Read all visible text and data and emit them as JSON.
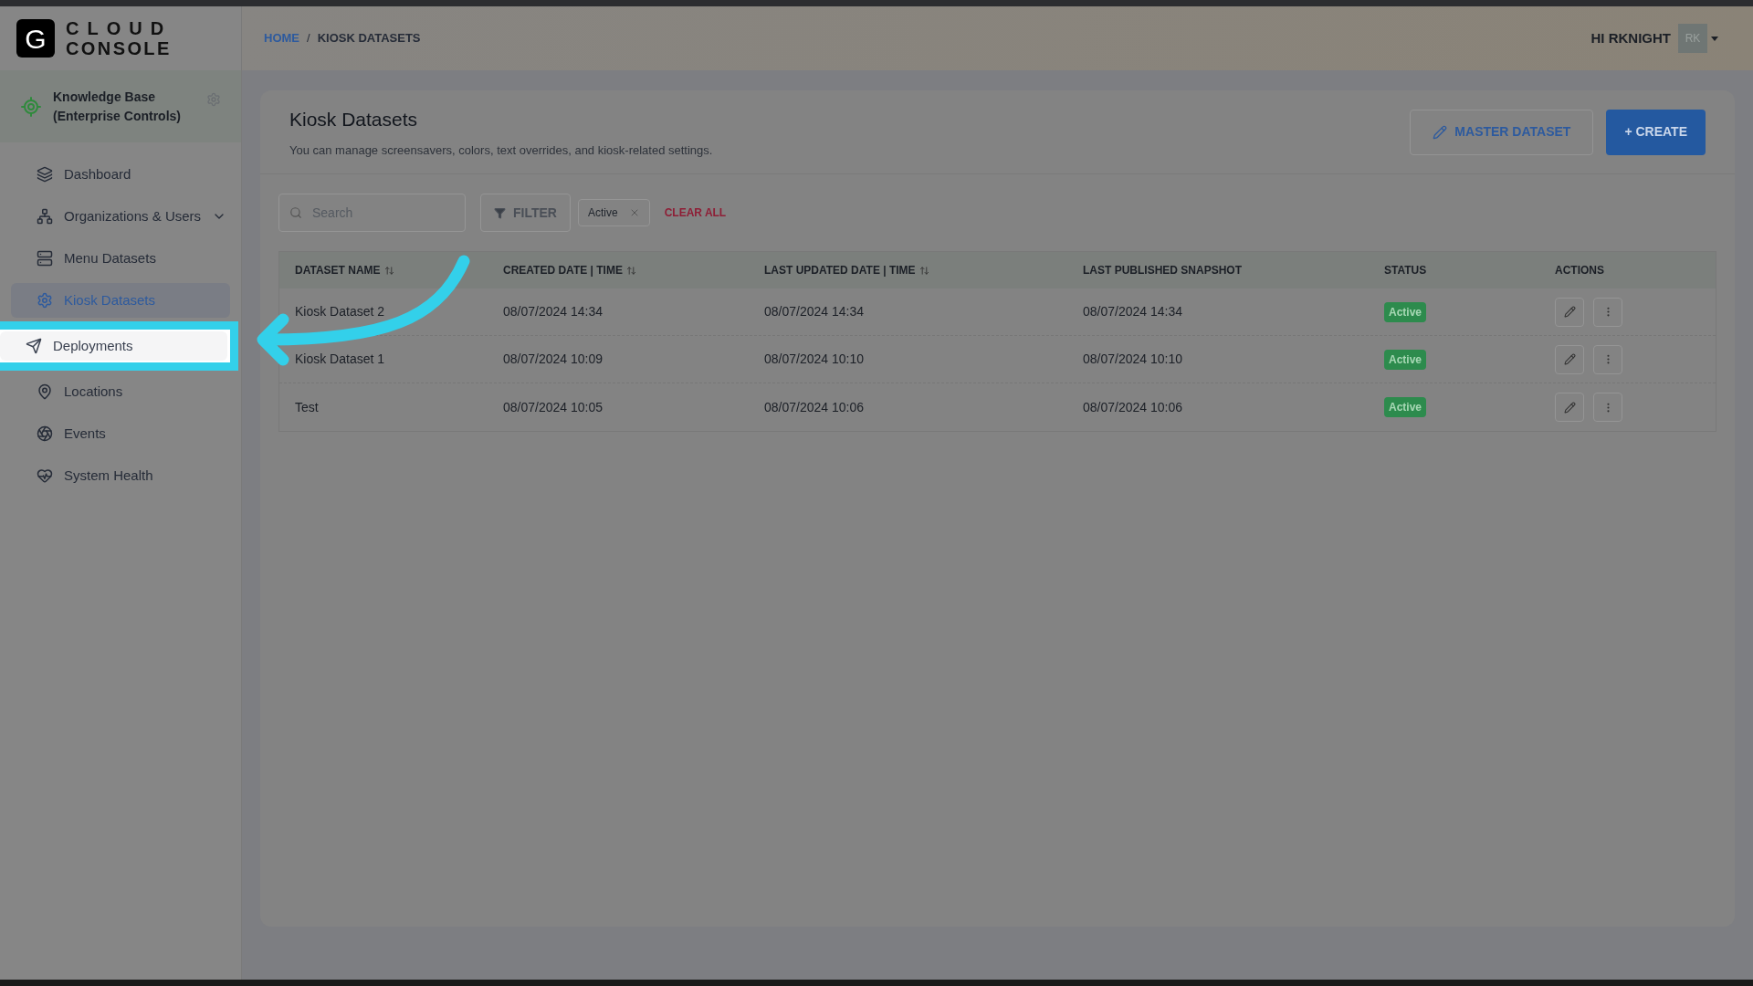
{
  "logo": {
    "letter": "G",
    "line_1": "CLOUD",
    "line_2": "CONSOLE"
  },
  "workspace": {
    "name": "Knowledge Base",
    "subtitle": "(Enterprise Controls)"
  },
  "sidebar": {
    "items": [
      {
        "label": "Dashboard",
        "kind": "link",
        "selected": false,
        "highlighted": false
      },
      {
        "label": "Organizations & Users",
        "kind": "group",
        "selected": false,
        "highlighted": false
      },
      {
        "label": "Menu Datasets",
        "kind": "link",
        "selected": false,
        "highlighted": false
      },
      {
        "label": "Kiosk Datasets",
        "kind": "link",
        "selected": true,
        "highlighted": false
      },
      {
        "label": "Deployments",
        "kind": "link",
        "selected": false,
        "highlighted": true
      },
      {
        "label": "Locations",
        "kind": "link",
        "selected": false,
        "highlighted": false
      },
      {
        "label": "Events",
        "kind": "link",
        "selected": false,
        "highlighted": false
      },
      {
        "label": "System Health",
        "kind": "link",
        "selected": false,
        "highlighted": false
      }
    ]
  },
  "breadcrumb": [
    {
      "label": "HOME",
      "kind": "link"
    },
    {
      "label": "/",
      "kind": "separator"
    },
    {
      "label": "KIOSK DATASETS",
      "kind": "current"
    }
  ],
  "user": {
    "greeting": "HI RKNIGHT",
    "initials": "RK"
  },
  "page": {
    "title": "Kiosk Datasets",
    "description": "You can manage screensavers, colors, text overrides, and kiosk-related settings.",
    "buttons": [
      {
        "label": "MASTER DATASET",
        "kind": "outline"
      },
      {
        "label": "+ CREATE",
        "kind": "primary"
      }
    ]
  },
  "toolbar": {
    "search": {
      "placeholder": "Search"
    },
    "filter_button": "FILTER",
    "chips": [
      "Active"
    ],
    "clear_all": "CLEAR ALL"
  },
  "table": {
    "columns": [
      {
        "label": "DATASET NAME",
        "sortable": true
      },
      {
        "label": "CREATED DATE | TIME",
        "sortable": true
      },
      {
        "label": "LAST UPDATED DATE | TIME",
        "sortable": true
      },
      {
        "label": "LAST PUBLISHED SNAPSHOT",
        "sortable": false
      },
      {
        "label": "STATUS",
        "sortable": false
      },
      {
        "label": "ACTIONS",
        "sortable": false
      }
    ],
    "rows": [
      {
        "name": "Kiosk Dataset 2",
        "created": "08/07/2024 14:34",
        "updated": "08/07/2024 14:34",
        "published": "08/07/2024 14:34",
        "status": "Active"
      },
      {
        "name": "Kiosk Dataset 1",
        "created": "08/07/2024 10:09",
        "updated": "08/07/2024 10:10",
        "published": "08/07/2024 10:10",
        "status": "Active"
      },
      {
        "name": "Test",
        "created": "08/07/2024 10:05",
        "updated": "08/07/2024 10:06",
        "published": "08/07/2024 10:06",
        "status": "Active"
      }
    ]
  }
}
